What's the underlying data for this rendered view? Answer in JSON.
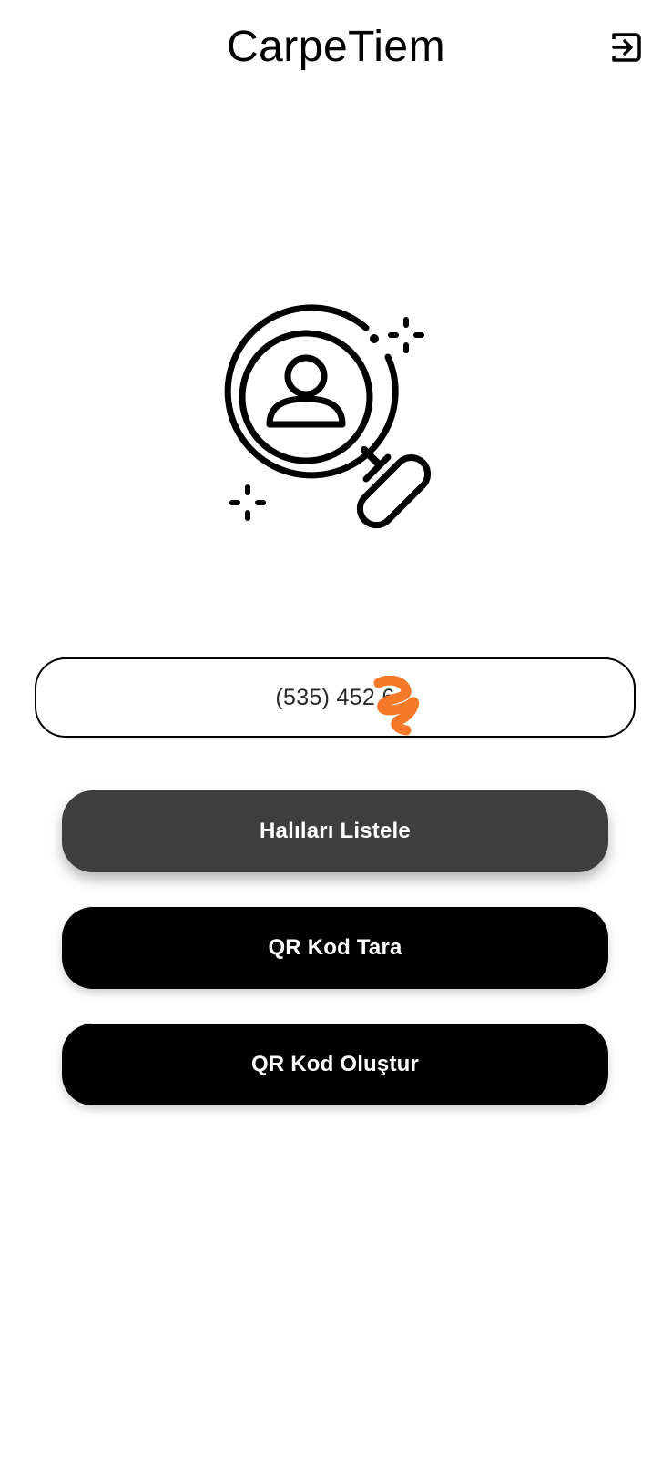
{
  "header": {
    "title": "CarpeTiem",
    "logout_icon": "logout-icon"
  },
  "hero": {
    "icon": "search-user-icon"
  },
  "search": {
    "value": "(535) 452 6"
  },
  "buttons": {
    "list_label": "Halıları Listele",
    "scan_label": "QR Kod Tara",
    "create_label": "QR Kod Oluştur"
  },
  "colors": {
    "primary": "#000000",
    "secondary_button": "#3e3e3e",
    "redaction": "#f47a2a",
    "background": "#ffffff"
  }
}
